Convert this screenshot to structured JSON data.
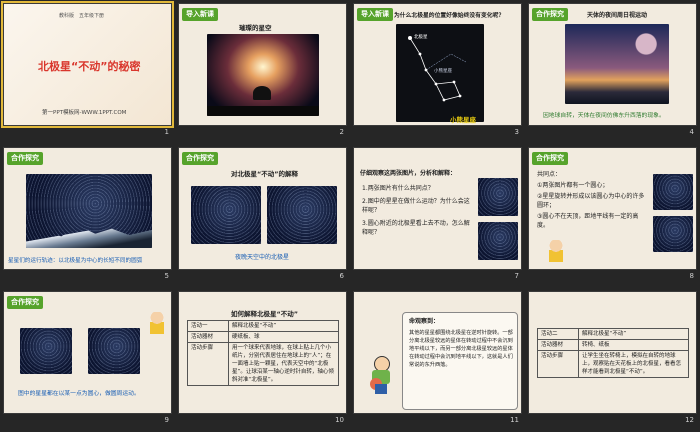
{
  "slides": [
    {
      "number": "1",
      "top_left": "教科版　五年级下册",
      "title": "北极星“不动”的秘密",
      "footer": "第一PPT模板网-WWW.1PPT.COM"
    },
    {
      "number": "2",
      "tag": "导入新课",
      "title": "璀璨的星空"
    },
    {
      "number": "3",
      "tag": "导入新课",
      "title": "为什么北极星的位置好像始终没有变化呢？",
      "star_label": "北极星",
      "labels": [
        "小熊星座"
      ],
      "bottom_label": "小熊星座"
    },
    {
      "number": "4",
      "tag": "合作探究",
      "title": "天体的夜间周日视运动",
      "caption": "因地球自转，天体在夜间仿佛东升西落的现象。"
    },
    {
      "number": "5",
      "tag": "合作探究",
      "caption": "星星们的运行轨迹：以北极星为中心的长短不同的圆弧"
    },
    {
      "number": "6",
      "tag": "合作探究",
      "title": "对北极星“不动”的解释",
      "caption": "夜晚天空中的北极星"
    },
    {
      "number": "7",
      "title": "仔细观察这两张图片，分析和解释：",
      "items": [
        "1.两张图片有什么共同点？",
        "2.图中的星星在做什么运动？为什么会这样呢？",
        "3.圆心附近的北极星看上去不动，怎么解释呢？"
      ]
    },
    {
      "number": "8",
      "tag": "合作探究",
      "heading": "共同点：",
      "items": [
        "①两张图片都有一个圆心；",
        "②星星旋转并形成以该圆心为中心的许多圆环；",
        "③圆心不在天顶，距地平线有一定的高度。"
      ]
    },
    {
      "number": "9",
      "tag": "合作探究",
      "caption": "图中的星星都在以某一点为圆心，做圆周运动。"
    },
    {
      "number": "10",
      "title": "如何解释北极星“不动”",
      "rows": [
        {
          "label": "活动一",
          "value": "解释北极星“不动”"
        },
        {
          "label": "活动器材",
          "value": "硬纸板、球"
        },
        {
          "label": "活动步骤",
          "value": "用一个球来代表地球，在球上贴上几个小纸片，分别代表居住在地球上的“人”；在一面墙上贴一颗星，代表天空中的“北极星”。让球沿某一轴心逆时针自转，轴心倾斜对准“北极星”。"
        }
      ]
    },
    {
      "number": "11",
      "heading": "命观察到：",
      "body": "其他的星星都围绕北极星在逆时针旋转。一部分离北极星较远的星体在转动过程中不会沉到地平线以下，而另一部分离北极星较远的星体在转动过程中会沉到地平线以下，这就是人们常说的东升西落。"
    },
    {
      "number": "12",
      "rows": [
        {
          "label": "活动二",
          "value": "解释北极星“不动”"
        },
        {
          "label": "活动器材",
          "value": "转椅、纸板"
        },
        {
          "label": "活动步骤",
          "value": "让学生坐在转椅上，模拟在自转的地球上，观察贴在天花板上的北极星，看看怎样才能看到北极星“不动”。"
        }
      ]
    }
  ]
}
